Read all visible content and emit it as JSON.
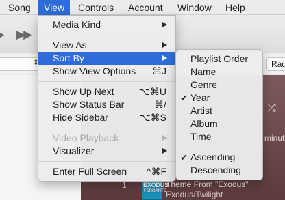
{
  "menubar": {
    "items": [
      "Song",
      "View",
      "Controls",
      "Account",
      "Window",
      "Help"
    ],
    "active": "View"
  },
  "background": {
    "playback_controls": "▶▶",
    "subbar_right_text": "Rad",
    "now_playing_partial": "minut",
    "track": {
      "number": "1",
      "title": "Theme From \"Exodus\"",
      "subtitle": "Exodus/Twilight",
      "art_title": "EXODUS",
      "art_subtitle": "FERRANTE"
    }
  },
  "view_menu": {
    "items": [
      {
        "label": "Media Kind",
        "shortcut": "",
        "submenu": true,
        "disabled": false,
        "highlighted": false
      },
      {
        "separator": true
      },
      {
        "label": "View As",
        "shortcut": "",
        "submenu": true,
        "disabled": false,
        "highlighted": false
      },
      {
        "label": "Sort By",
        "shortcut": "",
        "submenu": true,
        "disabled": false,
        "highlighted": true
      },
      {
        "label": "Show View Options",
        "shortcut": "⌘J",
        "submenu": false,
        "disabled": false,
        "highlighted": false
      },
      {
        "separator": true
      },
      {
        "label": "Show Up Next",
        "shortcut": "⌥⌘U",
        "submenu": false,
        "disabled": false,
        "highlighted": false
      },
      {
        "label": "Show Status Bar",
        "shortcut": "⌘/",
        "submenu": false,
        "disabled": false,
        "highlighted": false
      },
      {
        "label": "Hide Sidebar",
        "shortcut": "⌥⌘S",
        "submenu": false,
        "disabled": false,
        "highlighted": false
      },
      {
        "separator": true
      },
      {
        "label": "Video Playback",
        "shortcut": "",
        "submenu": true,
        "disabled": true,
        "highlighted": false
      },
      {
        "label": "Visualizer",
        "shortcut": "",
        "submenu": true,
        "disabled": false,
        "highlighted": false
      },
      {
        "separator": true
      },
      {
        "label": "Enter Full Screen",
        "shortcut": "^⌘F",
        "submenu": false,
        "disabled": false,
        "highlighted": false
      }
    ]
  },
  "sort_by_menu": {
    "items": [
      {
        "label": "Playlist Order",
        "checked": false
      },
      {
        "label": "Name",
        "checked": false
      },
      {
        "label": "Genre",
        "checked": false
      },
      {
        "label": "Year",
        "checked": true
      },
      {
        "label": "Artist",
        "checked": false
      },
      {
        "label": "Album",
        "checked": false
      },
      {
        "label": "Time",
        "checked": false
      },
      {
        "separator": true
      },
      {
        "label": "Ascending",
        "checked": true
      },
      {
        "label": "Descending",
        "checked": false
      }
    ]
  },
  "colors": {
    "highlight": "#2e6dd9",
    "menu_background": "#ececec",
    "now_playing_background": "#6e4a4c"
  }
}
